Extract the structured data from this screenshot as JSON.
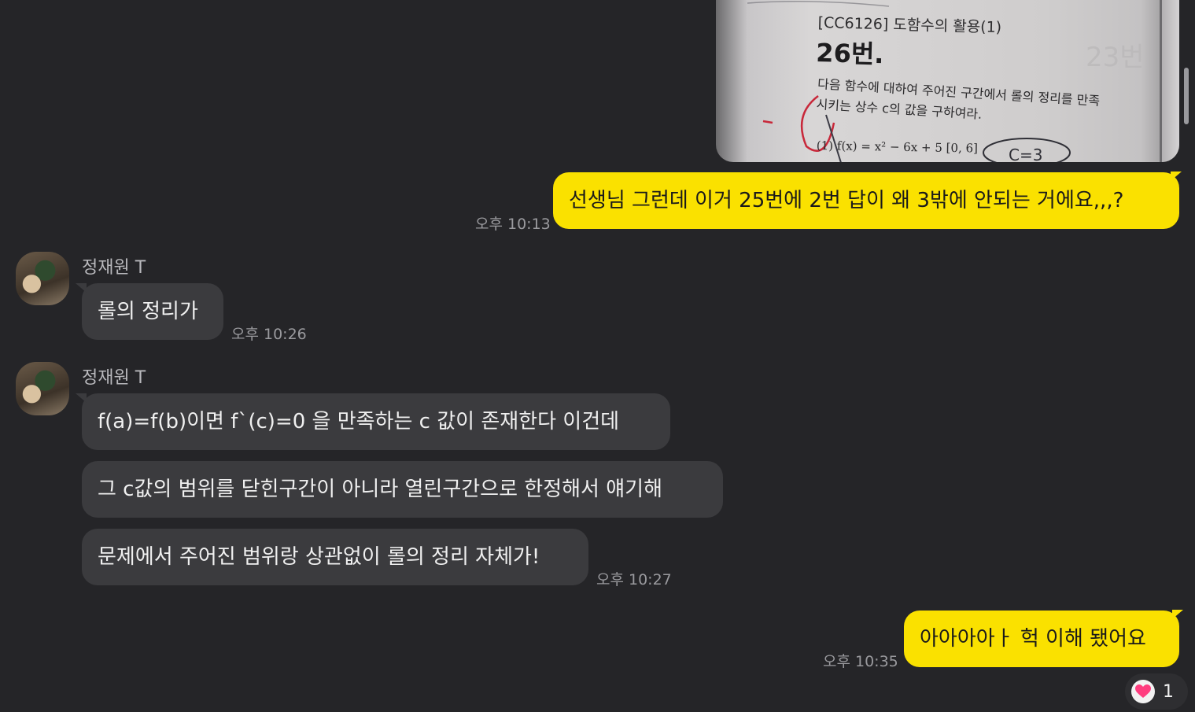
{
  "photo": {
    "code_line": "[CC6126] 도함수의 활용(1)",
    "question_number": "26번.",
    "question_line1": "다음 함수에 대하여 주어진 구간에서 롤의 정리를 만족",
    "question_line2": "시키는 상수 c의 값을 구하여라.",
    "formula": "(1) f(x) = x² − 6x + 5  [0, 6]"
  },
  "messages": [
    {
      "text": "선생님 그런데 이거 25번에 2번 답이 왜 3밖에 안되는 거에요,,,?",
      "time": "오후 10:13"
    },
    {
      "sender": "정재원 T",
      "text": "롤의 정리가",
      "time": "오후 10:26"
    },
    {
      "sender": "정재원 T",
      "text": "f(a)=f(b)이면 f`(c)=0 을 만족하는 c 값이 존재한다 이건데"
    },
    {
      "text": "그 c값의 범위를 닫힌구간이 아니라 열린구간으로 한정해서 얘기해"
    },
    {
      "text": "문제에서 주어진 범위랑 상관없이 롤의 정리 자체가!",
      "time": "오후 10:27"
    },
    {
      "text": "아아아아ㅏ 헉 이해 됐어요",
      "time": "오후 10:35"
    }
  ],
  "reaction": {
    "icon": "heart-icon",
    "count": "1",
    "color": "#ff3d7f"
  },
  "colors": {
    "my_bubble": "#fae100",
    "their_bubble": "#3b3b3e",
    "background": "#252528"
  }
}
